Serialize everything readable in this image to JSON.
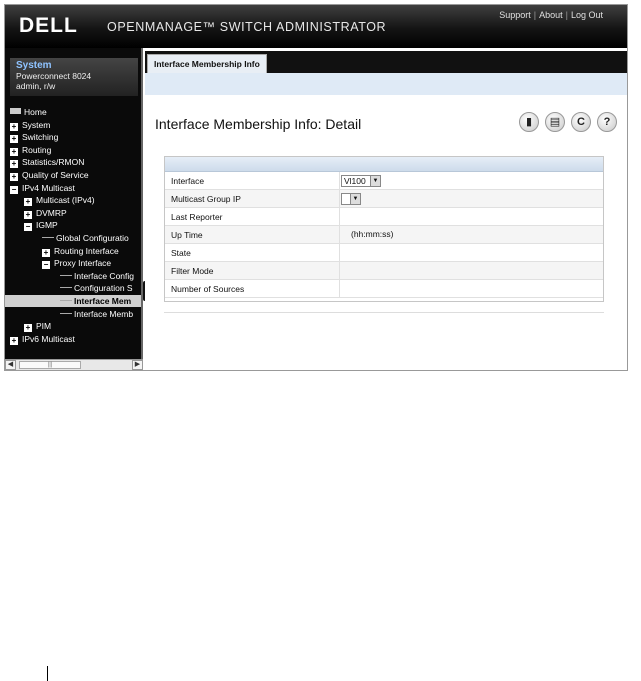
{
  "header": {
    "logo": "DELL",
    "title": "OPENMANAGE™ SWITCH ADMINISTRATOR",
    "links": [
      "Support",
      "About",
      "Log Out"
    ]
  },
  "sidebar": {
    "system": {
      "title": "System",
      "model": "Powerconnect 8024",
      "user": "admin, r/w"
    },
    "tree": [
      {
        "label": "Home",
        "kind": "home",
        "depth": 0
      },
      {
        "label": "System",
        "kind": "plus",
        "depth": 0
      },
      {
        "label": "Switching",
        "kind": "plus",
        "depth": 0
      },
      {
        "label": "Routing",
        "kind": "plus",
        "depth": 0
      },
      {
        "label": "Statistics/RMON",
        "kind": "plus",
        "depth": 0
      },
      {
        "label": "Quality of Service",
        "kind": "plus",
        "depth": 0
      },
      {
        "label": "IPv4 Multicast",
        "kind": "minus",
        "depth": 0
      },
      {
        "label": "Multicast (IPv4)",
        "kind": "plus",
        "depth": 1
      },
      {
        "label": "DVMRP",
        "kind": "plus",
        "depth": 1
      },
      {
        "label": "IGMP",
        "kind": "minus",
        "depth": 1
      },
      {
        "label": "Global Configuratio",
        "kind": "leaf",
        "depth": 2
      },
      {
        "label": "Routing Interface",
        "kind": "plus",
        "depth": 2
      },
      {
        "label": "Proxy Interface",
        "kind": "minus",
        "depth": 2
      },
      {
        "label": "Interface Config",
        "kind": "leaf",
        "depth": 3
      },
      {
        "label": "Configuration S",
        "kind": "leaf",
        "depth": 3
      },
      {
        "label": "Interface Mem",
        "kind": "leaf",
        "depth": 3,
        "selected": true
      },
      {
        "label": "Interface Memb",
        "kind": "leaf",
        "depth": 3
      },
      {
        "label": "PIM",
        "kind": "plus",
        "depth": 1
      },
      {
        "label": "IPv6 Multicast",
        "kind": "plus",
        "depth": 0
      }
    ]
  },
  "main": {
    "tab": "Interface Membership Info",
    "page_title": "Interface Membership Info: Detail",
    "tools": [
      "save-icon",
      "print-icon",
      "refresh-icon",
      "help-icon"
    ],
    "fields": [
      {
        "label": "Interface",
        "value": "Vl100",
        "type": "select"
      },
      {
        "label": "Multicast Group IP",
        "value": "",
        "type": "select"
      },
      {
        "label": "Last Reporter",
        "value": "",
        "type": "text"
      },
      {
        "label": "Up Time",
        "value": "(hh:mm:ss)",
        "type": "text"
      },
      {
        "label": "State",
        "value": "",
        "type": "text"
      },
      {
        "label": "Filter Mode",
        "value": "",
        "type": "text"
      },
      {
        "label": "Number of Sources",
        "value": "",
        "type": "text"
      }
    ]
  },
  "scrollbar": {
    "thumb_glyph": "|||"
  }
}
